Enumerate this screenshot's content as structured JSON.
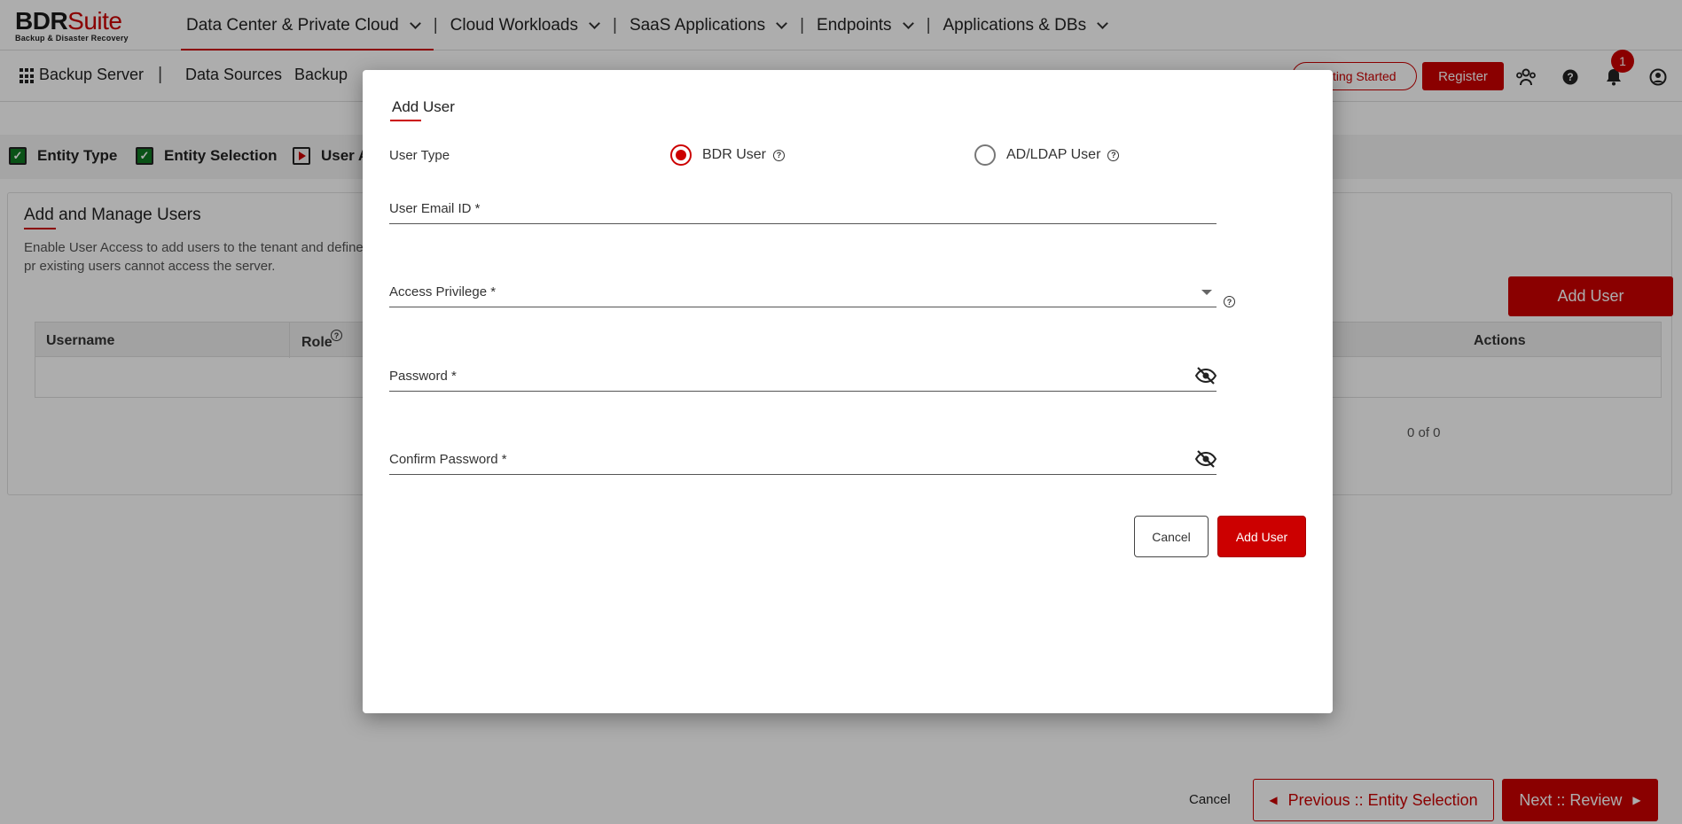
{
  "app": {
    "logo_brand_a": "BDR",
    "logo_brand_b": "Suite",
    "logo_tagline": "Backup & Disaster Recovery",
    "accent_color": "#cc0000"
  },
  "top_nav": {
    "items": [
      {
        "label": "Data Center & Private Cloud",
        "active": true
      },
      {
        "label": "Cloud Workloads"
      },
      {
        "label": "SaaS Applications"
      },
      {
        "label": "Endpoints"
      },
      {
        "label": "Applications & DBs"
      }
    ],
    "separator": "|"
  },
  "sub_nav": {
    "server_label": "Backup Server",
    "divider": "|",
    "items": [
      "Data Sources",
      "Backup"
    ],
    "getting_started": "Getting Started",
    "register": "Register",
    "notification_count": "1"
  },
  "steps": {
    "items": [
      {
        "label": "Entity Type",
        "state": "done"
      },
      {
        "label": "Entity Selection",
        "state": "done"
      },
      {
        "label": "User A",
        "state": "current"
      }
    ]
  },
  "card": {
    "title": "Add and Manage Users",
    "description": "Enable User Access to add users to the tenant and define pr existing users cannot access the server.",
    "add_user": "Add User",
    "columns": {
      "username": "Username",
      "role": "Role",
      "actions": "Actions"
    },
    "pager_text": "0 of 0"
  },
  "footer": {
    "cancel": "Cancel",
    "previous": "Previous :: Entity Selection",
    "next": "Next :: Review"
  },
  "modal": {
    "title": "Add User",
    "user_type_label": "User Type",
    "options": [
      {
        "label": "BDR User",
        "selected": true
      },
      {
        "label": "AD/LDAP User",
        "selected": false
      }
    ],
    "fields": {
      "email": "User Email ID *",
      "access": "Access Privilege *",
      "password": "Password *",
      "confirm": "Confirm Password *"
    },
    "cancel": "Cancel",
    "submit": "Add User"
  }
}
